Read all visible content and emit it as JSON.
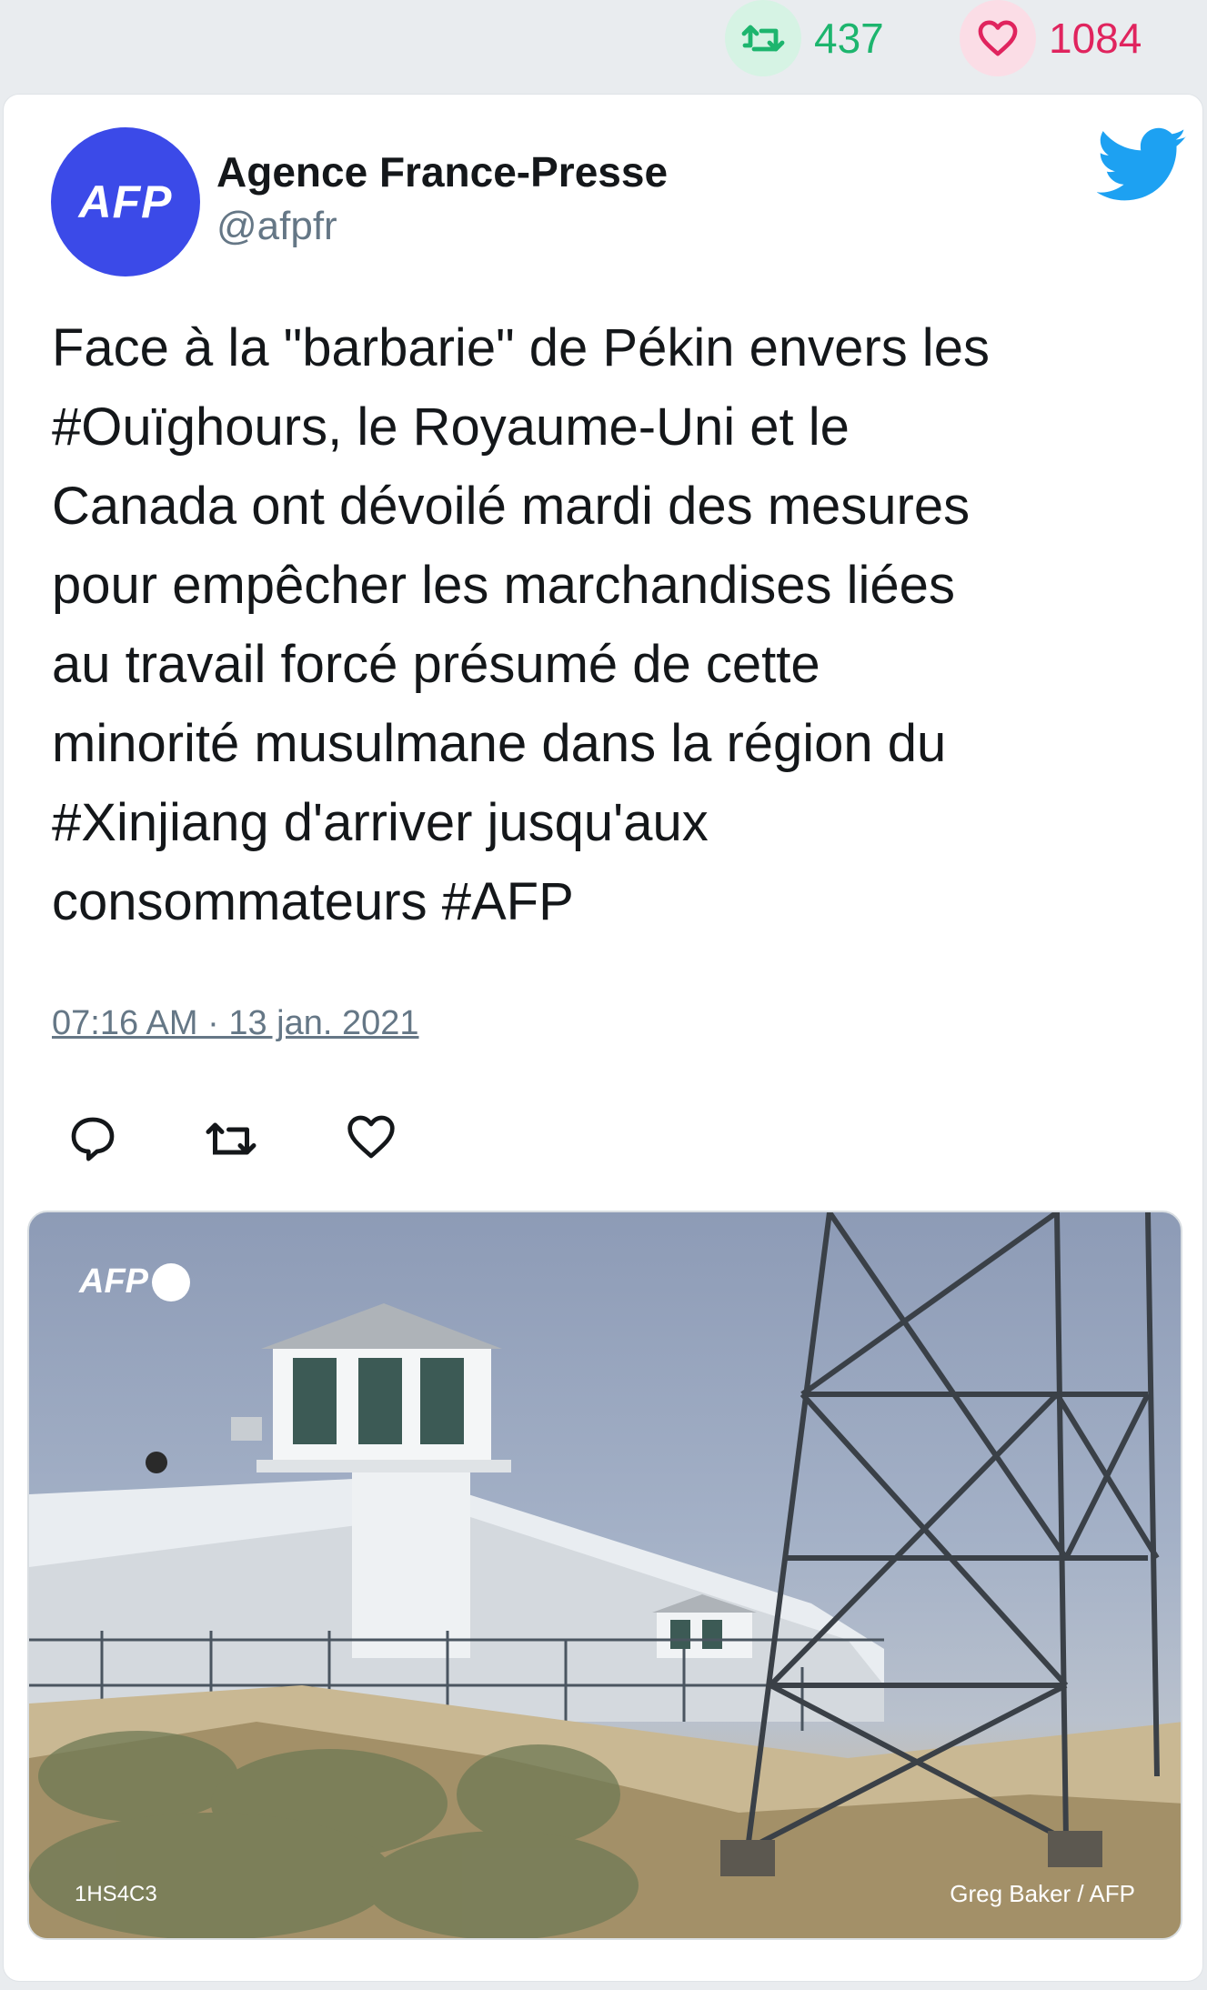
{
  "stats": {
    "retweets": "437",
    "likes": "1084"
  },
  "tweet": {
    "author_name": "Agence France-Presse",
    "author_handle": "@afpfr",
    "avatar_text": "AFP",
    "text_lines": [
      "Face à la \"barbarie\" de Pékin envers les",
      "#Ouïghours, le Royaume-Uni et le",
      "Canada ont dévoilé mardi des mesures",
      "pour empêcher les marchandises liées",
      "au travail forcé présumé de cette",
      "minorité musulmane dans la région du",
      "#Xinjiang d'arriver jusqu'aux",
      "consommateurs #AFP"
    ],
    "timestamp": "07:16 AM · 13 jan. 2021"
  },
  "media": {
    "logo_text": "AFP",
    "code": "1HS4C3",
    "credit": "Greg Baker / AFP"
  },
  "colors": {
    "retweet_green": "#1db56e",
    "like_red": "#e0245e",
    "twitter_blue": "#1da1f2",
    "avatar_blue": "#3b4ae8"
  },
  "icons": [
    "retweet-icon",
    "heart-icon",
    "twitter-bird-icon",
    "reply-icon"
  ]
}
